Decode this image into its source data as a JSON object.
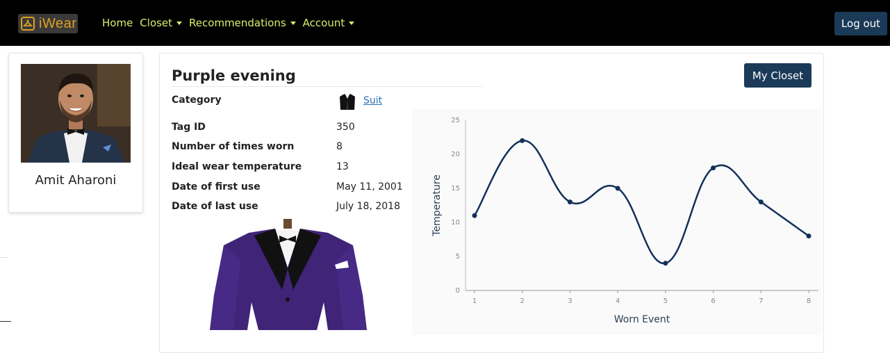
{
  "nav": {
    "brand": "iWear",
    "links": [
      {
        "label": "Home",
        "dropdown": false
      },
      {
        "label": "Closet",
        "dropdown": true
      },
      {
        "label": "Recommendations",
        "dropdown": true
      },
      {
        "label": "Account",
        "dropdown": true
      }
    ],
    "logout_label": "Log out"
  },
  "profile": {
    "name": "Amit Aharoni"
  },
  "item": {
    "title": "Purple evening",
    "my_closet_label": "My Closet",
    "category_label": "Category",
    "category_value": "Suit",
    "attributes": [
      {
        "label": "Tag ID",
        "value": "350"
      },
      {
        "label": "Number of times worn",
        "value": "8"
      },
      {
        "label": "Ideal wear temperature",
        "value": "13"
      },
      {
        "label": "Date of first use",
        "value": "May 11, 2001"
      },
      {
        "label": "Date of last use",
        "value": "July 18, 2018"
      }
    ]
  },
  "colors": {
    "navbar_bg": "#000000",
    "nav_link": "#d8f06c",
    "button_bg": "#1b3a57",
    "chart_line": "#12305a",
    "link": "#2a6fb3"
  },
  "chart_data": {
    "type": "line",
    "x": [
      1,
      2,
      3,
      4,
      5,
      6,
      7,
      8
    ],
    "values": [
      11,
      22,
      13,
      15,
      4,
      18,
      13,
      8
    ],
    "xlabel": "Worn Event",
    "ylabel": "Temperature",
    "ylim": [
      0,
      25
    ],
    "yticks": [
      0,
      5,
      10,
      15,
      20,
      25
    ],
    "smooth": true,
    "grid": false
  }
}
